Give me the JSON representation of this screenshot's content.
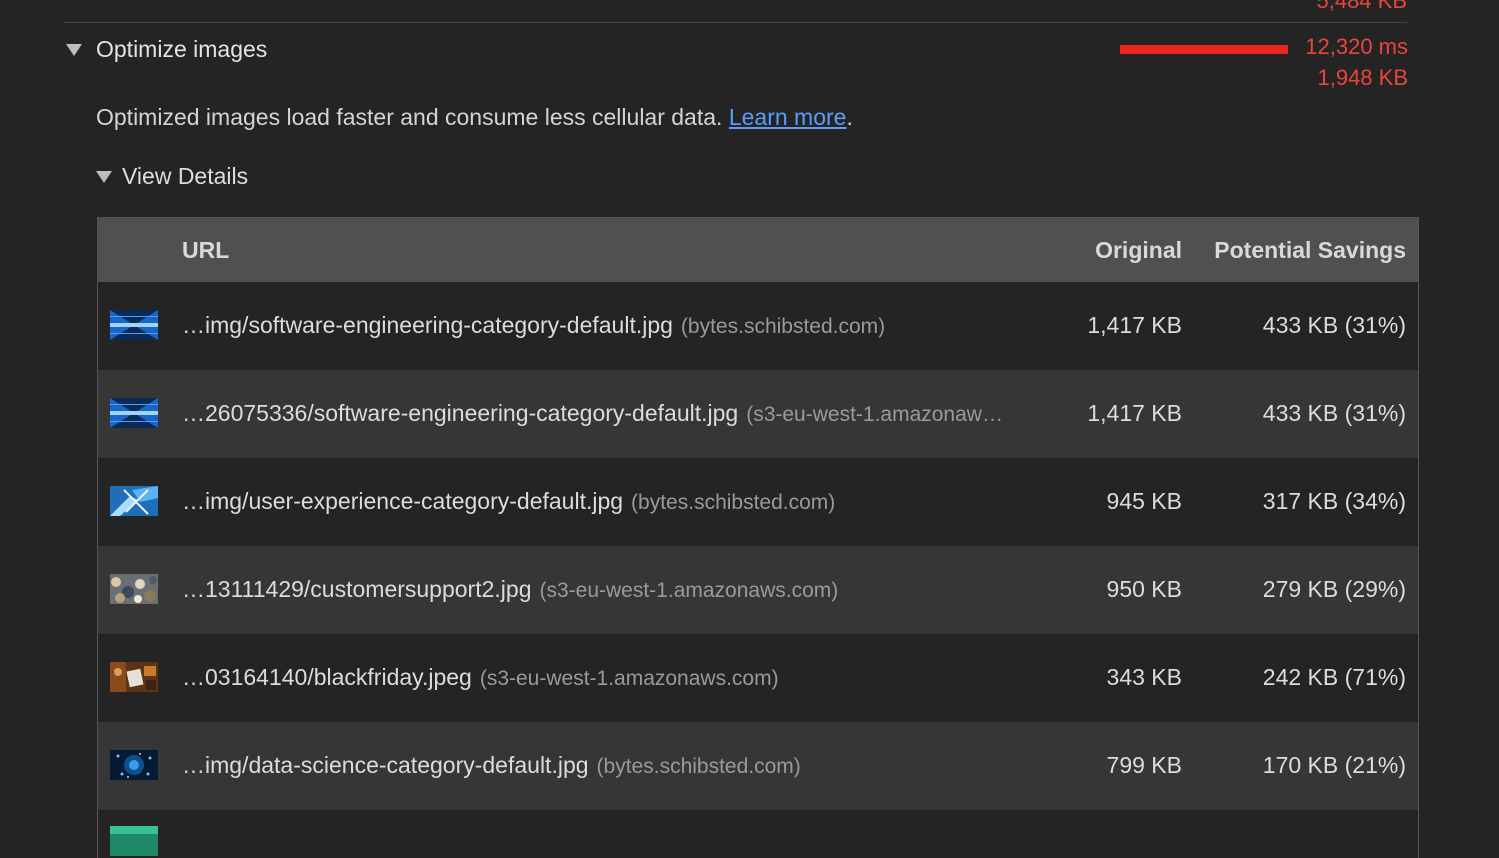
{
  "header": {
    "previous_value": "5,484 KB"
  },
  "audit": {
    "title": "Optimize images",
    "score_ms": "12,320 ms",
    "score_kb": "1,948 KB",
    "score_color": "#e8261e",
    "description": "Optimized images load faster and consume less cellular data.",
    "learn_more": "Learn more",
    "period": "."
  },
  "details": {
    "label": "View Details"
  },
  "table": {
    "headers": {
      "url": "URL",
      "original": "Original",
      "savings": "Potential Savings"
    },
    "rows": [
      {
        "thumb": "blue-tech-thumbnail",
        "url": "…img/software-engineering-category-default.jpg",
        "host": "(bytes.schibsted.com)",
        "original": "1,417 KB",
        "savings": "433 KB (31%)"
      },
      {
        "thumb": "blue-tech-thumbnail",
        "url": "…26075336/software-engineering-category-default.jpg",
        "host": "(s3-eu-west-1.amazonaw…",
        "original": "1,417 KB",
        "savings": "433 KB (31%)"
      },
      {
        "thumb": "blue-abstract-thumbnail",
        "url": "…img/user-experience-category-default.jpg",
        "host": "(bytes.schibsted.com)",
        "original": "945 KB",
        "savings": "317 KB (34%)"
      },
      {
        "thumb": "crowd-thumbnail",
        "url": "…13111429/customersupport2.jpg",
        "host": "(s3-eu-west-1.amazonaws.com)",
        "original": "950 KB",
        "savings": "279 KB (29%)"
      },
      {
        "thumb": "shopping-thumbnail",
        "url": "…03164140/blackfriday.jpeg",
        "host": "(s3-eu-west-1.amazonaws.com)",
        "original": "343 KB",
        "savings": "242 KB (71%)"
      },
      {
        "thumb": "particles-thumbnail",
        "url": "…img/data-science-category-default.jpg",
        "host": "(bytes.schibsted.com)",
        "original": "799 KB",
        "savings": "170 KB (21%)"
      }
    ]
  }
}
